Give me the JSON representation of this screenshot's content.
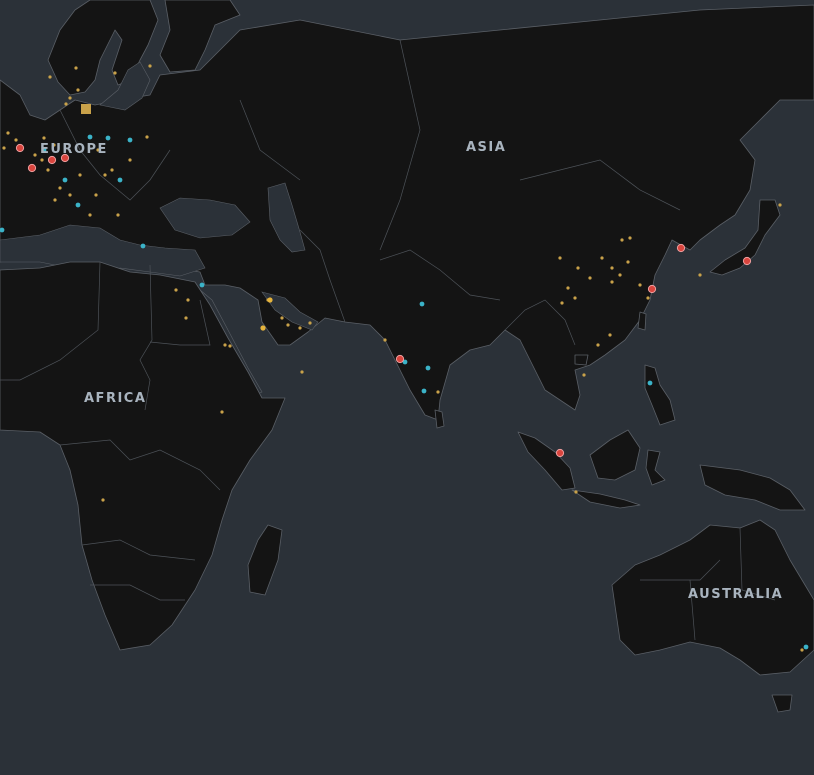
{
  "map": {
    "background_color": "#2b3138",
    "land_color": "#141414",
    "border_color": "#5a5f66",
    "marker_colors": {
      "small": "#c9a24a",
      "medium": "#3bb3c8",
      "large": "#d9453e",
      "square": "#c9a24a"
    }
  },
  "labels": {
    "europe": "EUROPE",
    "asia": "ASIA",
    "africa": "AFRICA",
    "australia": "AUSTRALIA"
  }
}
